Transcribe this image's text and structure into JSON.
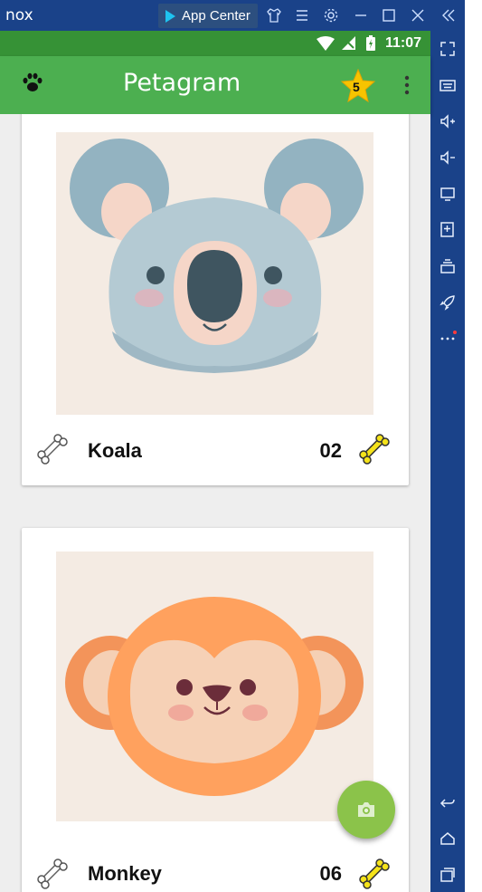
{
  "emulator": {
    "brand": "nox",
    "app_center_label": "App Center",
    "rail_icons": [
      "fullscreen-icon",
      "keyboard-icon",
      "volume-up-icon",
      "volume-down-icon",
      "screen-icon",
      "apk-install-icon",
      "multi-instance-icon",
      "rocket-icon",
      "more-icon",
      "back-icon",
      "home-icon",
      "recents-icon"
    ]
  },
  "status": {
    "time": "11:07"
  },
  "appbar": {
    "title": "Petagram",
    "rating_badge": "5"
  },
  "pets": [
    {
      "name": "Koala",
      "likes": "02"
    },
    {
      "name": "Monkey",
      "likes": "06"
    }
  ],
  "colors": {
    "primary": "#4caf50",
    "primary_dark": "#369236",
    "accent": "#8bc34a",
    "emulator": "#1a4289"
  }
}
